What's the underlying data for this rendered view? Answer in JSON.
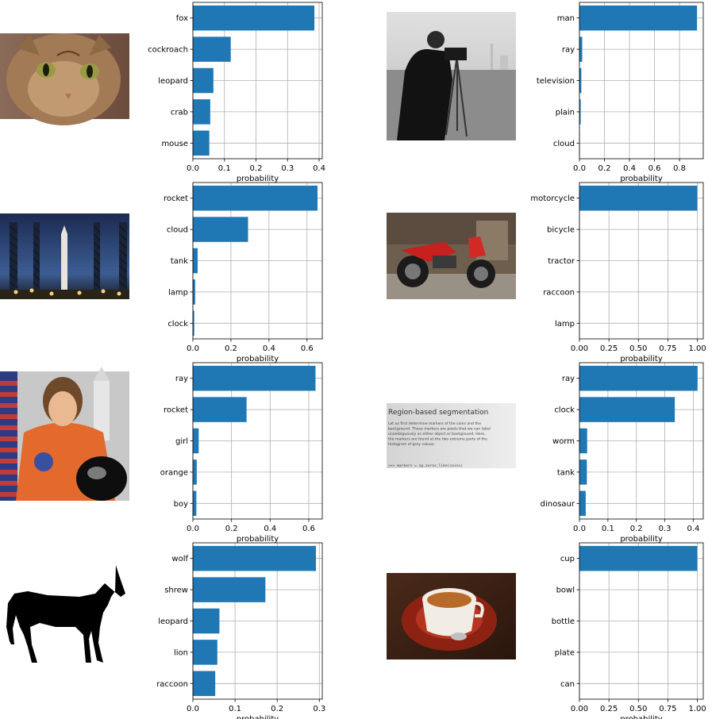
{
  "chart_data": [
    {
      "type": "bar",
      "orientation": "horizontal",
      "categories": [
        "fox",
        "cockroach",
        "leopard",
        "crab",
        "mouse"
      ],
      "values": [
        0.385,
        0.12,
        0.065,
        0.055,
        0.052
      ],
      "xlabel": "probability",
      "xlim": [
        0,
        0.41
      ],
      "xticks": [
        0,
        0.1,
        0.2,
        0.3,
        0.4
      ],
      "xtick_labels": [
        "0.0",
        "0.1",
        "0.2",
        "0.3",
        "0.4"
      ],
      "grid": true,
      "bar_color": "#1f77b4",
      "image": "cat-photo"
    },
    {
      "type": "bar",
      "orientation": "horizontal",
      "categories": [
        "man",
        "ray",
        "television",
        "plain",
        "cloud"
      ],
      "values": [
        0.94,
        0.022,
        0.015,
        0.01,
        0.003
      ],
      "xlabel": "probability",
      "xlim": [
        0,
        0.99
      ],
      "xticks": [
        0,
        0.2,
        0.4,
        0.6,
        0.8
      ],
      "xtick_labels": [
        "0.0",
        "0.2",
        "0.4",
        "0.6",
        "0.8"
      ],
      "grid": true,
      "bar_color": "#1f77b4",
      "image": "cameraman-photo"
    },
    {
      "type": "bar",
      "orientation": "horizontal",
      "categories": [
        "rocket",
        "cloud",
        "tank",
        "lamp",
        "clock"
      ],
      "values": [
        0.655,
        0.29,
        0.025,
        0.012,
        0.007
      ],
      "xlabel": "probability",
      "xlim": [
        0,
        0.68
      ],
      "xticks": [
        0,
        0.2,
        0.4,
        0.6
      ],
      "xtick_labels": [
        "0.0",
        "0.2",
        "0.4",
        "0.6"
      ],
      "grid": true,
      "bar_color": "#1f77b4",
      "image": "rocket-photo"
    },
    {
      "type": "bar",
      "orientation": "horizontal",
      "categories": [
        "motorcycle",
        "bicycle",
        "tractor",
        "raccoon",
        "lamp"
      ],
      "values": [
        0.999,
        0.0005,
        0.0004,
        0.0002,
        0.0001
      ],
      "xlabel": "probability",
      "xlim": [
        0,
        1.05
      ],
      "xticks": [
        0,
        0.25,
        0.5,
        0.75,
        1.0
      ],
      "xtick_labels": [
        "0.00",
        "0.25",
        "0.50",
        "0.75",
        "1.00"
      ],
      "grid": true,
      "bar_color": "#1f77b4",
      "image": "motorcycle-photo"
    },
    {
      "type": "bar",
      "orientation": "horizontal",
      "categories": [
        "ray",
        "rocket",
        "girl",
        "orange",
        "boy"
      ],
      "values": [
        0.635,
        0.278,
        0.03,
        0.02,
        0.018
      ],
      "xlabel": "probability",
      "xlim": [
        0,
        0.67
      ],
      "xticks": [
        0,
        0.2,
        0.4,
        0.6
      ],
      "xtick_labels": [
        "0.0",
        "0.2",
        "0.4",
        "0.6"
      ],
      "grid": true,
      "bar_color": "#1f77b4",
      "image": "astronaut-photo"
    },
    {
      "type": "bar",
      "orientation": "horizontal",
      "categories": [
        "ray",
        "clock",
        "worm",
        "tank",
        "dinosaur"
      ],
      "values": [
        0.415,
        0.335,
        0.027,
        0.026,
        0.022
      ],
      "xlabel": "probability",
      "xlim": [
        0,
        0.435
      ],
      "xticks": [
        0,
        0.1,
        0.2,
        0.3,
        0.4
      ],
      "xtick_labels": [
        "0.0",
        "0.1",
        "0.2",
        "0.3",
        "0.4"
      ],
      "grid": true,
      "bar_color": "#1f77b4",
      "image": "text-page-photo"
    },
    {
      "type": "bar",
      "orientation": "horizontal",
      "categories": [
        "wolf",
        "shrew",
        "leopard",
        "lion",
        "raccoon"
      ],
      "values": [
        0.292,
        0.172,
        0.063,
        0.058,
        0.053
      ],
      "xlabel": "probability",
      "xlim": [
        0,
        0.307
      ],
      "xticks": [
        0,
        0.1,
        0.2,
        0.3
      ],
      "xtick_labels": [
        "0.0",
        "0.1",
        "0.2",
        "0.3"
      ],
      "grid": true,
      "bar_color": "#1f77b4",
      "image": "horse-silhouette"
    },
    {
      "type": "bar",
      "orientation": "horizontal",
      "categories": [
        "cup",
        "bowl",
        "bottle",
        "plate",
        "can"
      ],
      "values": [
        0.999,
        0.0006,
        0.0003,
        0.0002,
        0.0001
      ],
      "xlabel": "probability",
      "xlim": [
        0,
        1.05
      ],
      "xticks": [
        0,
        0.25,
        0.5,
        0.75,
        1.0
      ],
      "xtick_labels": [
        "0.00",
        "0.25",
        "0.50",
        "0.75",
        "1.00"
      ],
      "grid": true,
      "bar_color": "#1f77b4",
      "image": "coffee-photo"
    }
  ],
  "text_page": {
    "heading": "Region-based segmentation",
    "lines": [
      "Let us first determine markers of the coins and the",
      "background. These markers are pixels that we can label",
      "unambiguously as either object or background. Here,",
      "the markers are found at the two extreme parts of the",
      "histogram of grey values:"
    ],
    "code": ">>> markers = np.zeros_like(coins)"
  },
  "colors": {
    "bar": "#1f77b4",
    "grid": "#b0b0b0",
    "axis": "#000000"
  }
}
